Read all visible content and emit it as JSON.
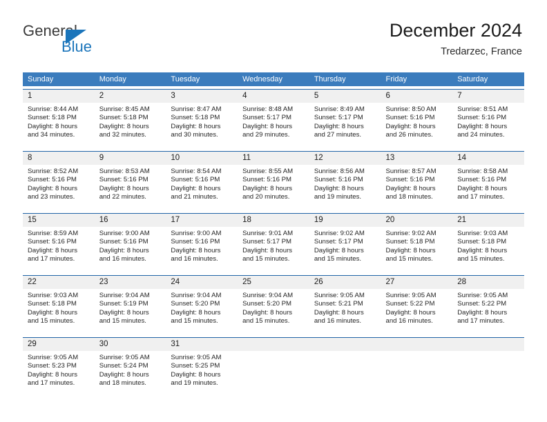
{
  "brand": {
    "name_part1": "General",
    "name_part2": "Blue",
    "color_blue": "#1b75bb",
    "color_dark": "#3a3a3a",
    "triangle_icon": "triangle-icon"
  },
  "header": {
    "title": "December 2024",
    "subtitle": "Tredarzec, France"
  },
  "calendar": {
    "header_bg": "#3b7cbd",
    "row_divider": "#1f63a6",
    "daynum_bg": "#f0f0f0",
    "weekdays": [
      "Sunday",
      "Monday",
      "Tuesday",
      "Wednesday",
      "Thursday",
      "Friday",
      "Saturday"
    ],
    "weeks": [
      [
        {
          "day": "1",
          "sunrise": "Sunrise: 8:44 AM",
          "sunset": "Sunset: 5:18 PM",
          "daylight1": "Daylight: 8 hours",
          "daylight2": "and 34 minutes."
        },
        {
          "day": "2",
          "sunrise": "Sunrise: 8:45 AM",
          "sunset": "Sunset: 5:18 PM",
          "daylight1": "Daylight: 8 hours",
          "daylight2": "and 32 minutes."
        },
        {
          "day": "3",
          "sunrise": "Sunrise: 8:47 AM",
          "sunset": "Sunset: 5:18 PM",
          "daylight1": "Daylight: 8 hours",
          "daylight2": "and 30 minutes."
        },
        {
          "day": "4",
          "sunrise": "Sunrise: 8:48 AM",
          "sunset": "Sunset: 5:17 PM",
          "daylight1": "Daylight: 8 hours",
          "daylight2": "and 29 minutes."
        },
        {
          "day": "5",
          "sunrise": "Sunrise: 8:49 AM",
          "sunset": "Sunset: 5:17 PM",
          "daylight1": "Daylight: 8 hours",
          "daylight2": "and 27 minutes."
        },
        {
          "day": "6",
          "sunrise": "Sunrise: 8:50 AM",
          "sunset": "Sunset: 5:16 PM",
          "daylight1": "Daylight: 8 hours",
          "daylight2": "and 26 minutes."
        },
        {
          "day": "7",
          "sunrise": "Sunrise: 8:51 AM",
          "sunset": "Sunset: 5:16 PM",
          "daylight1": "Daylight: 8 hours",
          "daylight2": "and 24 minutes."
        }
      ],
      [
        {
          "day": "8",
          "sunrise": "Sunrise: 8:52 AM",
          "sunset": "Sunset: 5:16 PM",
          "daylight1": "Daylight: 8 hours",
          "daylight2": "and 23 minutes."
        },
        {
          "day": "9",
          "sunrise": "Sunrise: 8:53 AM",
          "sunset": "Sunset: 5:16 PM",
          "daylight1": "Daylight: 8 hours",
          "daylight2": "and 22 minutes."
        },
        {
          "day": "10",
          "sunrise": "Sunrise: 8:54 AM",
          "sunset": "Sunset: 5:16 PM",
          "daylight1": "Daylight: 8 hours",
          "daylight2": "and 21 minutes."
        },
        {
          "day": "11",
          "sunrise": "Sunrise: 8:55 AM",
          "sunset": "Sunset: 5:16 PM",
          "daylight1": "Daylight: 8 hours",
          "daylight2": "and 20 minutes."
        },
        {
          "day": "12",
          "sunrise": "Sunrise: 8:56 AM",
          "sunset": "Sunset: 5:16 PM",
          "daylight1": "Daylight: 8 hours",
          "daylight2": "and 19 minutes."
        },
        {
          "day": "13",
          "sunrise": "Sunrise: 8:57 AM",
          "sunset": "Sunset: 5:16 PM",
          "daylight1": "Daylight: 8 hours",
          "daylight2": "and 18 minutes."
        },
        {
          "day": "14",
          "sunrise": "Sunrise: 8:58 AM",
          "sunset": "Sunset: 5:16 PM",
          "daylight1": "Daylight: 8 hours",
          "daylight2": "and 17 minutes."
        }
      ],
      [
        {
          "day": "15",
          "sunrise": "Sunrise: 8:59 AM",
          "sunset": "Sunset: 5:16 PM",
          "daylight1": "Daylight: 8 hours",
          "daylight2": "and 17 minutes."
        },
        {
          "day": "16",
          "sunrise": "Sunrise: 9:00 AM",
          "sunset": "Sunset: 5:16 PM",
          "daylight1": "Daylight: 8 hours",
          "daylight2": "and 16 minutes."
        },
        {
          "day": "17",
          "sunrise": "Sunrise: 9:00 AM",
          "sunset": "Sunset: 5:16 PM",
          "daylight1": "Daylight: 8 hours",
          "daylight2": "and 16 minutes."
        },
        {
          "day": "18",
          "sunrise": "Sunrise: 9:01 AM",
          "sunset": "Sunset: 5:17 PM",
          "daylight1": "Daylight: 8 hours",
          "daylight2": "and 15 minutes."
        },
        {
          "day": "19",
          "sunrise": "Sunrise: 9:02 AM",
          "sunset": "Sunset: 5:17 PM",
          "daylight1": "Daylight: 8 hours",
          "daylight2": "and 15 minutes."
        },
        {
          "day": "20",
          "sunrise": "Sunrise: 9:02 AM",
          "sunset": "Sunset: 5:18 PM",
          "daylight1": "Daylight: 8 hours",
          "daylight2": "and 15 minutes."
        },
        {
          "day": "21",
          "sunrise": "Sunrise: 9:03 AM",
          "sunset": "Sunset: 5:18 PM",
          "daylight1": "Daylight: 8 hours",
          "daylight2": "and 15 minutes."
        }
      ],
      [
        {
          "day": "22",
          "sunrise": "Sunrise: 9:03 AM",
          "sunset": "Sunset: 5:18 PM",
          "daylight1": "Daylight: 8 hours",
          "daylight2": "and 15 minutes."
        },
        {
          "day": "23",
          "sunrise": "Sunrise: 9:04 AM",
          "sunset": "Sunset: 5:19 PM",
          "daylight1": "Daylight: 8 hours",
          "daylight2": "and 15 minutes."
        },
        {
          "day": "24",
          "sunrise": "Sunrise: 9:04 AM",
          "sunset": "Sunset: 5:20 PM",
          "daylight1": "Daylight: 8 hours",
          "daylight2": "and 15 minutes."
        },
        {
          "day": "25",
          "sunrise": "Sunrise: 9:04 AM",
          "sunset": "Sunset: 5:20 PM",
          "daylight1": "Daylight: 8 hours",
          "daylight2": "and 15 minutes."
        },
        {
          "day": "26",
          "sunrise": "Sunrise: 9:05 AM",
          "sunset": "Sunset: 5:21 PM",
          "daylight1": "Daylight: 8 hours",
          "daylight2": "and 16 minutes."
        },
        {
          "day": "27",
          "sunrise": "Sunrise: 9:05 AM",
          "sunset": "Sunset: 5:22 PM",
          "daylight1": "Daylight: 8 hours",
          "daylight2": "and 16 minutes."
        },
        {
          "day": "28",
          "sunrise": "Sunrise: 9:05 AM",
          "sunset": "Sunset: 5:22 PM",
          "daylight1": "Daylight: 8 hours",
          "daylight2": "and 17 minutes."
        }
      ],
      [
        {
          "day": "29",
          "sunrise": "Sunrise: 9:05 AM",
          "sunset": "Sunset: 5:23 PM",
          "daylight1": "Daylight: 8 hours",
          "daylight2": "and 17 minutes."
        },
        {
          "day": "30",
          "sunrise": "Sunrise: 9:05 AM",
          "sunset": "Sunset: 5:24 PM",
          "daylight1": "Daylight: 8 hours",
          "daylight2": "and 18 minutes."
        },
        {
          "day": "31",
          "sunrise": "Sunrise: 9:05 AM",
          "sunset": "Sunset: 5:25 PM",
          "daylight1": "Daylight: 8 hours",
          "daylight2": "and 19 minutes."
        },
        {
          "day": "",
          "sunrise": "",
          "sunset": "",
          "daylight1": "",
          "daylight2": ""
        },
        {
          "day": "",
          "sunrise": "",
          "sunset": "",
          "daylight1": "",
          "daylight2": ""
        },
        {
          "day": "",
          "sunrise": "",
          "sunset": "",
          "daylight1": "",
          "daylight2": ""
        },
        {
          "day": "",
          "sunrise": "",
          "sunset": "",
          "daylight1": "",
          "daylight2": ""
        }
      ]
    ]
  }
}
